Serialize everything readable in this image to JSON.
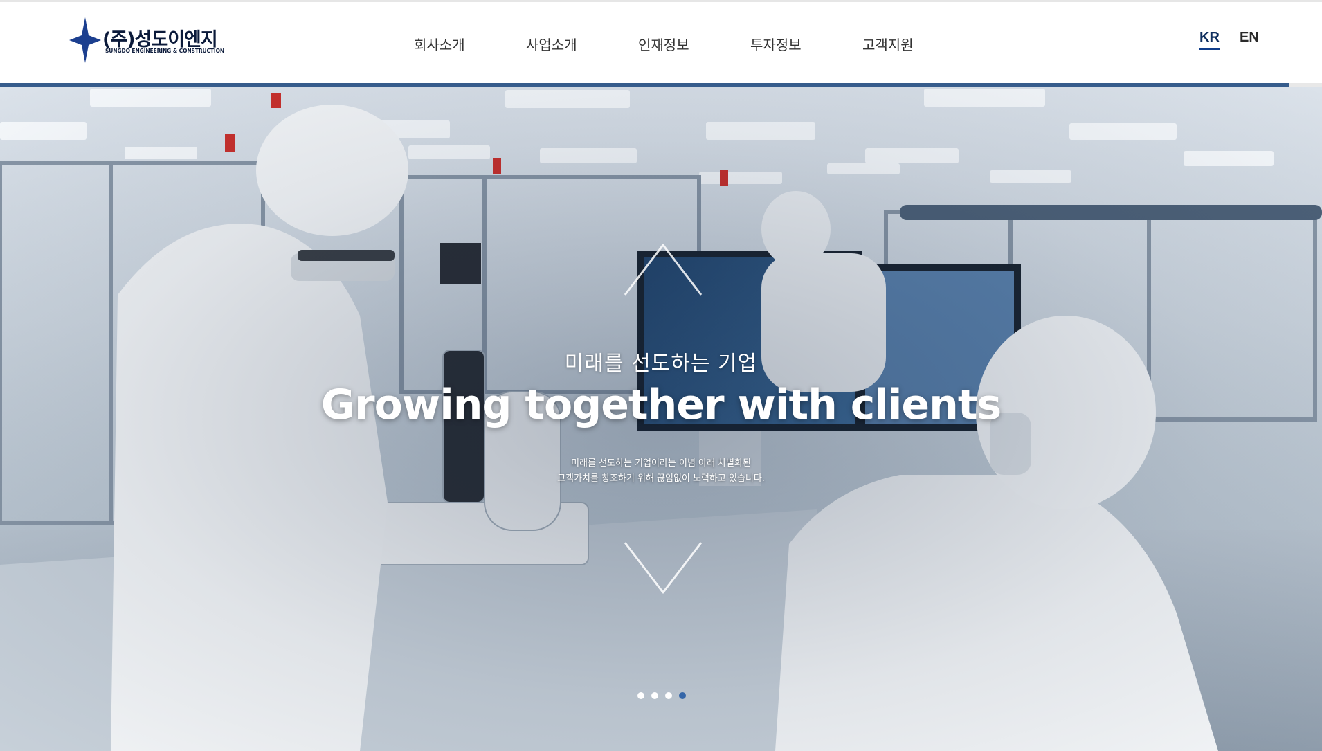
{
  "header": {
    "logo": {
      "korean": "(주)성도이엔지",
      "english": "SUNGDO ENGINEERING & CONSTRUCTION",
      "star_color": "#1c3f8f"
    },
    "nav": [
      {
        "label": "회사소개"
      },
      {
        "label": "사업소개"
      },
      {
        "label": "인재정보"
      },
      {
        "label": "투자정보"
      },
      {
        "label": "고객지원"
      }
    ],
    "lang": {
      "kr": "KR",
      "en": "EN",
      "active": "KR"
    }
  },
  "slide_progress": {
    "fraction": 0.975,
    "color": "#365c8c"
  },
  "hero": {
    "subtitle": "미래를 선도하는 기업",
    "title": "Growing together with clients",
    "desc_line1": "미래를 선도하는 기업이라는 이념 아래 차별화된",
    "desc_line2": "고객가치를 창조하기 위해 끊임없이 노력하고 있습니다.",
    "background": "cleanroom laboratory with researchers in white protective suits, microscope, test tubes and monitors"
  },
  "pagination": {
    "count": 4,
    "active_index": 3,
    "active_color": "#3566a8"
  }
}
